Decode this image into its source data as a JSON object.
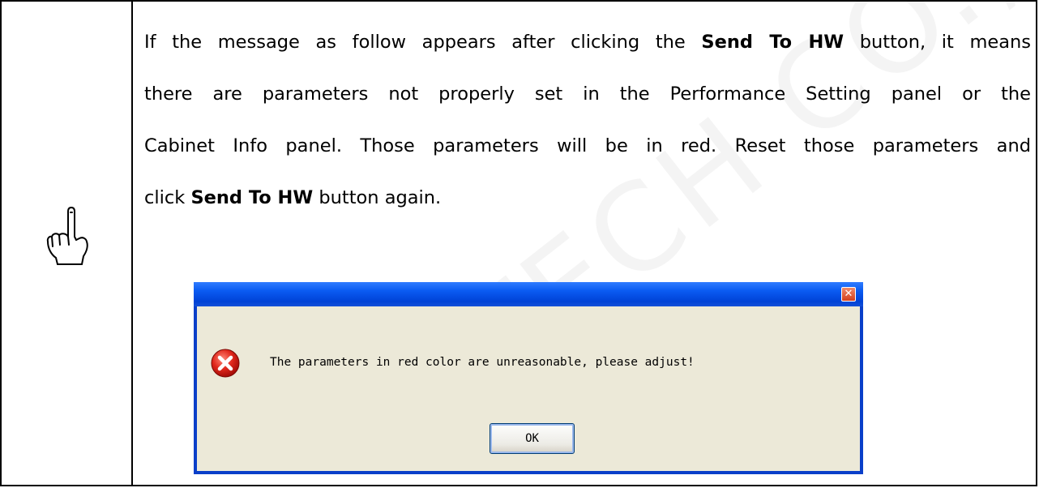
{
  "note": {
    "icon": "pointing-hand-icon",
    "paragraph": {
      "l1_a": "If the message as follow appears after clicking the ",
      "l1_b": "Send To HW",
      "l1_c": " button, it means",
      "l2": "there are parameters not properly set in the Performance Setting panel or the",
      "l3": "Cabinet Info panel. Those parameters will be in red. Reset those parameters and",
      "l4_a": "click ",
      "l4_b": "Send To HW",
      "l4_c": " button again."
    }
  },
  "dialog": {
    "icon": "error-icon",
    "message": "The parameters in red color are unreasonable, please adjust!",
    "ok_label": "OK",
    "close_icon": "close-icon"
  },
  "watermark": "R-TECH CO., L"
}
